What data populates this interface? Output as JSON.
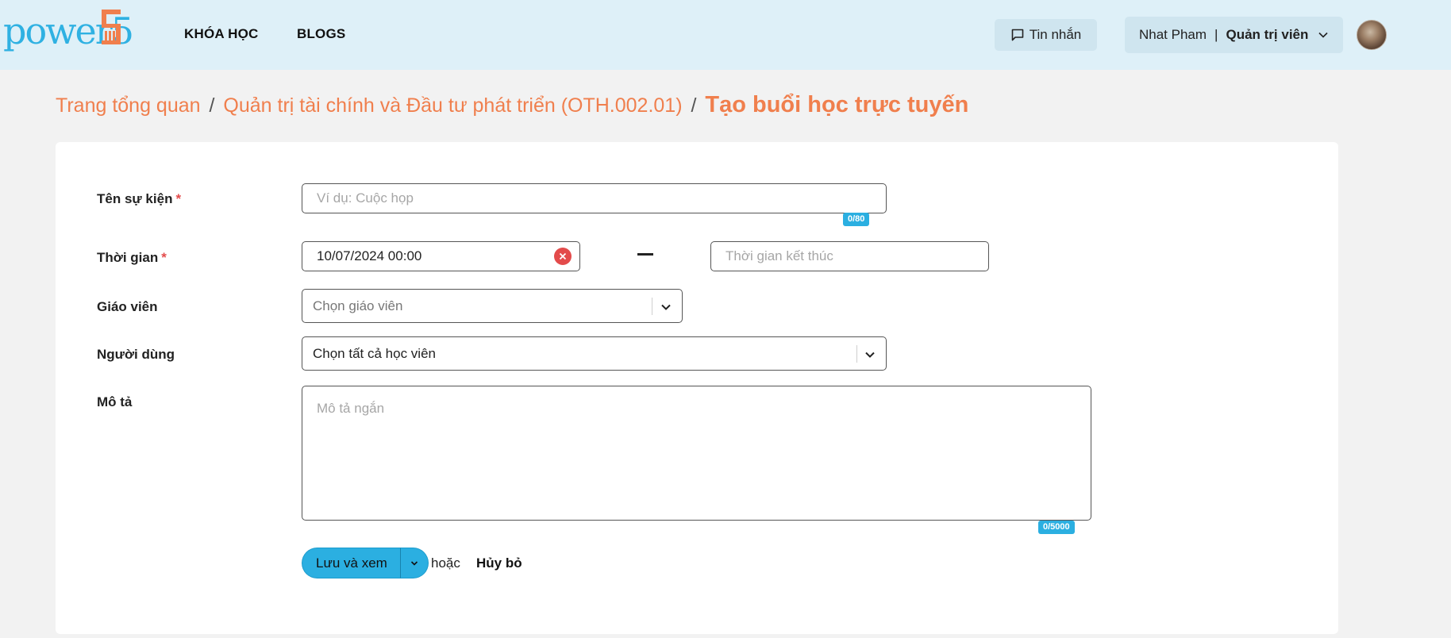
{
  "header": {
    "logo_text": "power5",
    "nav": [
      {
        "label": "KHÓA HỌC"
      },
      {
        "label": "BLOGS"
      }
    ],
    "messages_label": "Tin nhắn",
    "user_name": "Nhat Pham",
    "user_separator": "|",
    "user_role": "Quản trị viên"
  },
  "breadcrumb": {
    "items": [
      "Trang tổng quan",
      "Quản trị tài chính và Đầu tư phát triển (OTH.002.01)"
    ],
    "separator": "/",
    "current": "Tạo buổi học trực tuyến"
  },
  "form": {
    "event_name": {
      "label": "Tên sự kiện",
      "required_mark": "*",
      "placeholder": "Ví dụ: Cuộc họp",
      "value": "",
      "counter": "0/80"
    },
    "time": {
      "label": "Thời gian",
      "required_mark": "*",
      "start_value": "10/07/2024 00:00",
      "end_placeholder": "Thời gian kết thúc"
    },
    "teacher": {
      "label": "Giáo viên",
      "placeholder": "Chọn giáo viên"
    },
    "users": {
      "label": "Người dùng",
      "value": "Chọn tất cả học viên"
    },
    "description": {
      "label": "Mô tả",
      "placeholder": "Mô tả ngắn",
      "counter": "0/5000"
    }
  },
  "actions": {
    "save_label": "Lưu và xem",
    "or_label": "hoặc",
    "cancel_label": "Hủy bỏ"
  },
  "colors": {
    "accent_orange": "#f07f4d",
    "accent_blue": "#2bafe1",
    "header_bg": "#def0f8",
    "required_red": "#e34b4b"
  },
  "icons": [
    "chat-bubble-icon",
    "chevron-down-icon",
    "clear-icon",
    "logo-mark-icon"
  ]
}
